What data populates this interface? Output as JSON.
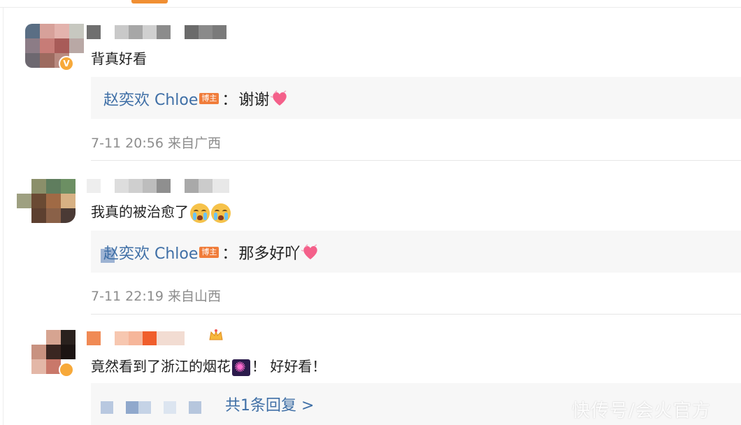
{
  "comments": [
    {
      "text": "背真好看",
      "reply": {
        "author": "赵奕欢 Chloe",
        "tag": "博主",
        "sep": "：",
        "text": "谢谢"
      },
      "meta": "7-11 20:56 来自广西"
    },
    {
      "text": "我真的被治愈了",
      "reply": {
        "author": "赵奕欢 Chloe",
        "tag": "博主",
        "sep": "：",
        "text": "那多好吖"
      },
      "meta": "7-11 22:19 来自山西"
    },
    {
      "text_a": "竟然看到了浙江的烟花",
      "text_b": "！ 好好看！",
      "more_replies": "共1条回复 >"
    }
  ],
  "watermark": "快传号/会火官方",
  "icons": {
    "verified": "verified-badge-icon",
    "heart": "heart-icon",
    "cry": "crying-face-icon",
    "firework": "firework-icon",
    "crown": "crown-icon"
  },
  "colors": {
    "accent": "#f08f33",
    "link": "#3f6fa6",
    "meta": "#8d8d8d",
    "reply_bg": "#f7f7f7",
    "blogger_tag": "#f07d3b"
  }
}
